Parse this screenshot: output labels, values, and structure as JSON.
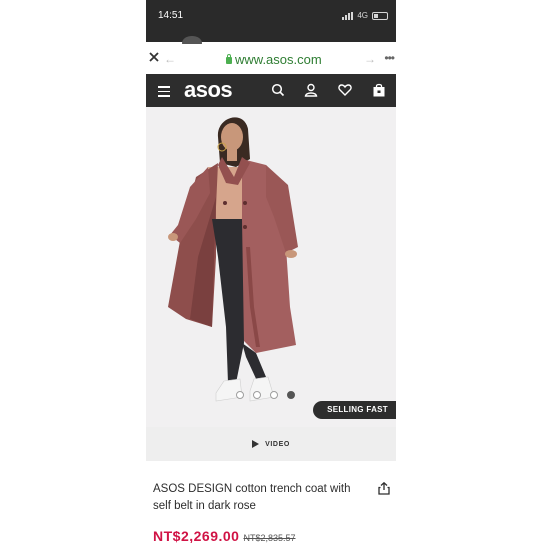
{
  "status_bar": {
    "time": "14:51",
    "network": "4G"
  },
  "browser": {
    "url": "www.asos.com"
  },
  "header": {
    "logo": "asos"
  },
  "product": {
    "selling_badge": "SELLING FAST",
    "video_label": "VIDEO",
    "title": "ASOS DESIGN cotton trench coat with self belt in dark rose",
    "price_now": "NT$2,269.00",
    "price_was": "NT$2,835.57",
    "carousel_dots": 4,
    "carousel_active": 4
  },
  "colors": {
    "header_bg": "#2d2d2d",
    "price": "#d01345",
    "url": "#2e7d32",
    "coat": "#a35f5f"
  },
  "icons": [
    "close-icon",
    "back-icon",
    "forward-icon",
    "more-icon",
    "lock-icon",
    "menu-icon",
    "search-icon",
    "account-icon",
    "wishlist-icon",
    "bag-icon",
    "play-icon",
    "share-icon"
  ]
}
